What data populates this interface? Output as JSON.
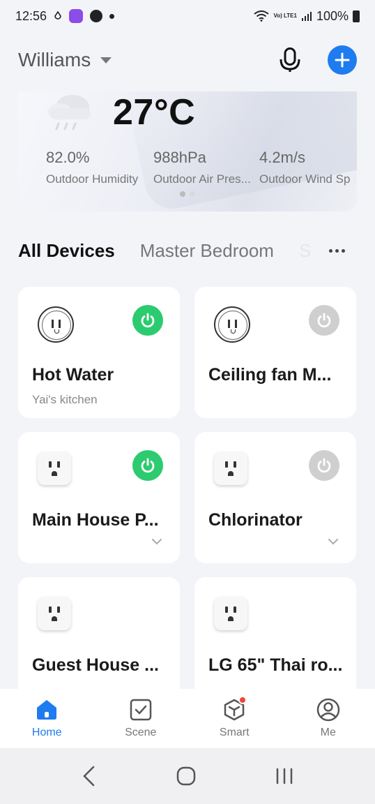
{
  "status_bar": {
    "time": "12:56",
    "battery": "100%",
    "network": "Vo) LTE1",
    "icons": [
      "drop-icon",
      "app-badge-icon",
      "chat-icon",
      "notification-dot",
      "wifi-icon",
      "signal-icon",
      "battery-icon"
    ]
  },
  "header": {
    "home_name": "Williams",
    "mic_icon": "microphone-icon",
    "add_icon": "plus-icon",
    "accent_color": "#1f7bf0"
  },
  "weather": {
    "icon": "rain-cloud-icon",
    "temperature": "27°C",
    "metrics": [
      {
        "value": "82.0%",
        "label": "Outdoor Humidity"
      },
      {
        "value": "988hPa",
        "label": "Outdoor Air Pres..."
      },
      {
        "value": "4.2m/s",
        "label": "Outdoor Wind Sp"
      }
    ],
    "pager": {
      "pages": 2,
      "active": 1
    }
  },
  "tabs": {
    "items": [
      "All Devices",
      "Master Bedroom",
      "S"
    ],
    "active": "All Devices"
  },
  "devices": [
    {
      "name": "Hot Water",
      "room": "Yai's kitchen",
      "icon": "round-socket-icon",
      "power": "on"
    },
    {
      "name": "Ceiling fan M...",
      "room": "",
      "icon": "round-socket-icon",
      "power": "off"
    },
    {
      "name": "Main House P...",
      "room": "",
      "icon": "square-socket-icon",
      "power": "on"
    },
    {
      "name": "Chlorinator",
      "room": "",
      "icon": "square-socket-icon",
      "power": "off"
    },
    {
      "name": "Guest House ...",
      "room": "",
      "icon": "square-socket-icon",
      "power": ""
    },
    {
      "name": "LG 65\" Thai ro...",
      "room": "",
      "icon": "square-socket-icon",
      "power": ""
    }
  ],
  "colors": {
    "power_on": "#2ccb6f",
    "power_off": "#cfcfcf",
    "notification": "#f0443b"
  },
  "bottom_nav": {
    "items": [
      {
        "label": "Home",
        "icon": "home-icon"
      },
      {
        "label": "Scene",
        "icon": "scene-checkbox-icon"
      },
      {
        "label": "Smart",
        "icon": "smart-cube-icon"
      },
      {
        "label": "Me",
        "icon": "user-icon"
      }
    ],
    "active": "Home"
  },
  "system_nav": [
    "back-icon",
    "home-circle-icon",
    "recents-icon"
  ]
}
